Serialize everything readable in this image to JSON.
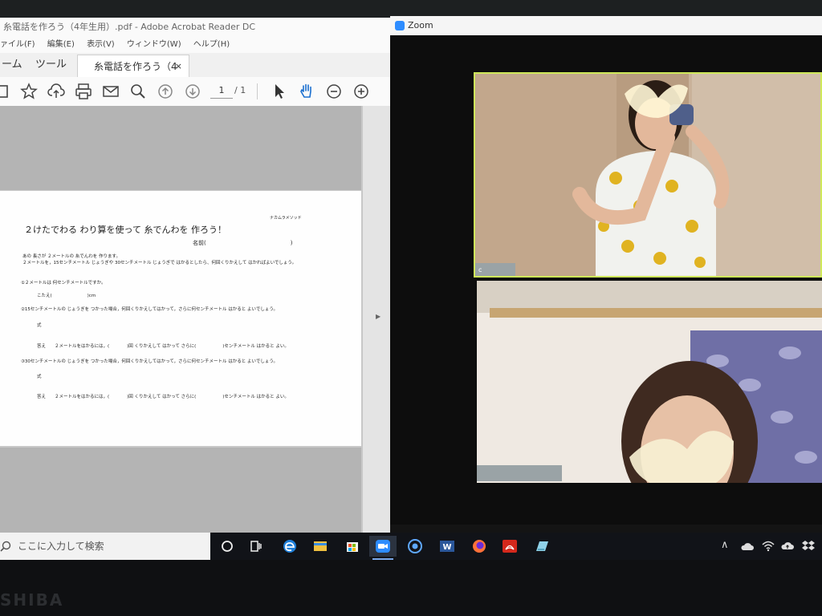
{
  "brand": "SHIBA",
  "acrobat": {
    "title": "糸電話を作ろう（4年生用）.pdf - Adobe Acrobat Reader DC",
    "menu": [
      "ァイル(F)",
      "編集(E)",
      "表示(V)",
      "ウィンドウ(W)",
      "ヘルプ(H)"
    ],
    "tabs": {
      "home": "ーム",
      "tools": "ツール",
      "document": "糸電話を作ろう（4年...",
      "close": "×"
    },
    "page_current": "1",
    "page_total": "/ 1",
    "document": {
      "header_small": "ナカムラメソッド",
      "title": "２けたでわる わり算を使って 糸でんわを 作ろう！",
      "name_label": "名前(　　　　　　　　　　　　　　　)",
      "intro1": "あの 長さが ２メートルの 糸でんわを 作ります。",
      "intro2": "２メートルを，15センチメートル じょうぎや 30センチメートル じょうぎで はかるとしたら、何回くりかえして はかればよいでしょう。",
      "q1": "①２メートルは 何センチメートルですか。",
      "a1": "こたえ(　　　　　　　　)cm",
      "q2": "②15センチメートルの じょうぎを つかった場合，何回くりかえしてはかって，さらに何センチメートル はかると よいでしょう。",
      "shiki2": "式",
      "ans2": "答え　　２メートルをはかるには，(　　　　)回 くりかえして はかって さらに(　　　　　　)センチメートル はかると よい。",
      "q3": "③30センチメートルの じょうぎを つかった場合，何回くりかえしてはかって，さらに何センチメートル はかると よいでしょう。",
      "shiki3": "式",
      "ans3": "答え　　２メートルをはかるには，(　　　　)回 くりかえして はかって さらに(　　　　　　)センチメートル はかると よい。"
    }
  },
  "zoom": {
    "title": "Zoom",
    "tile1_label": "c"
  },
  "taskbar": {
    "search_placeholder": "ここに入力して検索"
  },
  "colors": {
    "zoom_blue": "#2d8cff",
    "active_speaker_border": "#cfe85a",
    "taskbar": "#111318"
  }
}
